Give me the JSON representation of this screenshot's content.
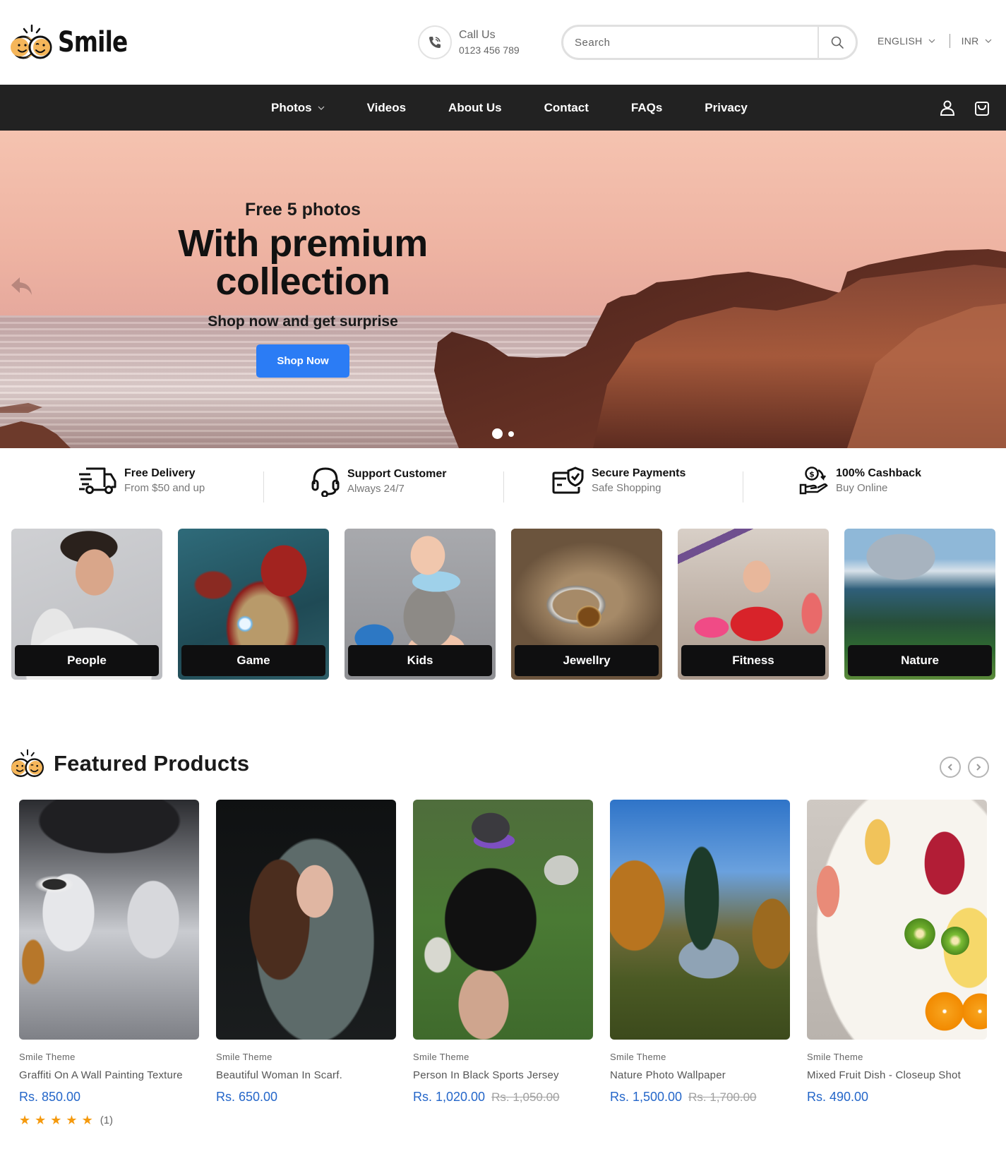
{
  "brand": {
    "name": "Smile"
  },
  "header": {
    "call_label": "Call Us",
    "call_number": "0123 456 789",
    "search_placeholder": "Search",
    "language": "ENGLISH",
    "currency": "INR"
  },
  "nav": {
    "items": [
      {
        "label": "Photos",
        "has_dropdown": true
      },
      {
        "label": "Videos"
      },
      {
        "label": "About Us"
      },
      {
        "label": "Contact"
      },
      {
        "label": "FAQs"
      },
      {
        "label": "Privacy"
      }
    ]
  },
  "hero": {
    "subtitle": "Free 5 photos",
    "title_line1": "With premium",
    "title_line2": "collection",
    "tagline": "Shop now and get surprise",
    "button_label": "Shop Now",
    "slide_count": 2,
    "active_slide": 1,
    "accent_color": "#2b7cf5"
  },
  "features": [
    {
      "title": "Free Delivery",
      "subtitle": "From $50 and up",
      "icon": "truck-icon"
    },
    {
      "title": "Support Customer",
      "subtitle": "Always 24/7",
      "icon": "headset-icon"
    },
    {
      "title": "Secure Payments",
      "subtitle": "Safe Shopping",
      "icon": "secure-card-icon"
    },
    {
      "title": "100% Cashback",
      "subtitle": "Buy Online",
      "icon": "cashback-hand-icon"
    }
  ],
  "categories": [
    {
      "label": "People"
    },
    {
      "label": "Game"
    },
    {
      "label": "Kids"
    },
    {
      "label": "Jewellry"
    },
    {
      "label": "Fitness"
    },
    {
      "label": "Nature"
    }
  ],
  "featured": {
    "title": "Featured Products",
    "products": [
      {
        "vendor": "Smile Theme",
        "title": "Graffiti On A Wall Painting Texture",
        "price": "Rs. 850.00",
        "compare_price": "",
        "rating": 5,
        "rating_max": 5,
        "review_count": "(1)"
      },
      {
        "vendor": "Smile Theme",
        "title": "Beautiful Woman In Scarf.",
        "price": "Rs. 650.00",
        "compare_price": ""
      },
      {
        "vendor": "Smile Theme",
        "title": "Person In Black Sports Jersey",
        "price": "Rs. 1,020.00",
        "compare_price": "Rs. 1,050.00"
      },
      {
        "vendor": "Smile Theme",
        "title": "Nature Photo Wallpaper",
        "price": "Rs. 1,500.00",
        "compare_price": "Rs. 1,700.00"
      },
      {
        "vendor": "Smile Theme",
        "title": "Mixed Fruit Dish - Closeup Shot",
        "price": "Rs. 490.00",
        "compare_price": ""
      }
    ]
  },
  "colors": {
    "nav_bg": "#222222",
    "price": "#2466c9",
    "star": "#f59a0e",
    "logo_face": "#f5b65a"
  }
}
